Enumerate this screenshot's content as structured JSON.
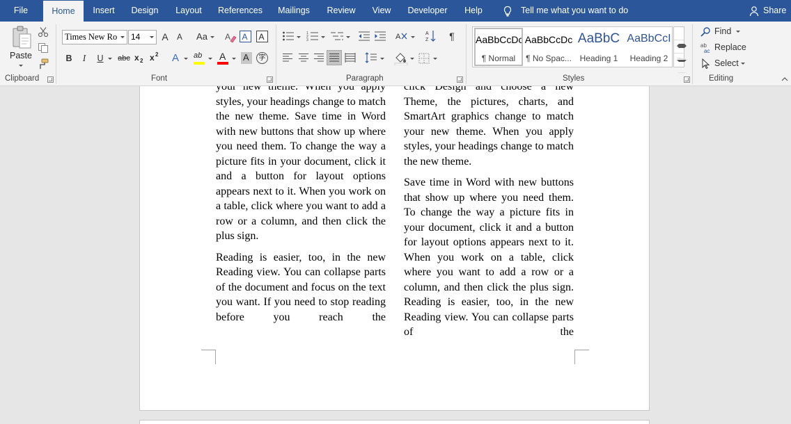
{
  "tabs": [
    {
      "label": "File"
    },
    {
      "label": "Home"
    },
    {
      "label": "Insert"
    },
    {
      "label": "Design"
    },
    {
      "label": "Layout"
    },
    {
      "label": "References"
    },
    {
      "label": "Mailings"
    },
    {
      "label": "Review"
    },
    {
      "label": "View"
    },
    {
      "label": "Developer"
    },
    {
      "label": "Help"
    }
  ],
  "tell_me": "Tell me what you want to do",
  "share": "Share",
  "clipboard": {
    "paste_label": "Paste",
    "group_label": "Clipboard"
  },
  "font": {
    "name_value": "Times New Ro",
    "size_value": "14",
    "group_label": "Font",
    "change_case": "Aa",
    "grow": "A",
    "shrink": "A",
    "bold": "B",
    "italic": "I",
    "underline": "U",
    "strike": "abc",
    "subscript": "x",
    "superscript": "x",
    "effects": "A",
    "highlight": "ab",
    "font_color": "A",
    "shading": "A",
    "enclosed": "字",
    "colors": {
      "highlight": "#ffff00",
      "font_color": "#ff0000"
    }
  },
  "paragraph": {
    "group_label": "Paragraph"
  },
  "styles": {
    "group_label": "Styles",
    "items": [
      {
        "sample": "AaBbCcDc",
        "name": "¶ Normal",
        "selected": true
      },
      {
        "sample": "AaBbCcDc",
        "name": "¶ No Spac..."
      },
      {
        "sample": "AaBbC",
        "name": "Heading 1"
      },
      {
        "sample": "AaBbCcI",
        "name": "Heading 2"
      }
    ]
  },
  "editing": {
    "group_label": "Editing",
    "find": "Find",
    "replace": "Replace",
    "select": "Select"
  },
  "accent_color": "#2b579a",
  "document": {
    "columns": [
      {
        "paragraphs": [
          "your new theme. When you apply styles, your headings change to match the new theme. Save time in Word with new buttons that show up where you need them. To change the way a picture fits in your document, click it and a button for layout options appears next to it. When you work on a table, click where you want to add a row or a column, and then click the plus sign.",
          "Reading is easier, too, in the new Reading view. You can collapse parts of the document and focus on the text you want. If you need to stop reading before you reach the"
        ]
      },
      {
        "paragraphs": [
          "click Design and choose a new Theme, the pictures, charts, and SmartArt graphics change to match your new theme. When you apply styles, your headings change to match the new theme.",
          "Save time in Word with new buttons that show up where you need them. To change the way a picture fits in your document, click it and a button for layout options appears next to it. When you work on a table, click where you want to add a row or a column, and then click the plus sign. Reading is easier, too, in the new Reading view. You can collapse parts of the"
        ]
      }
    ]
  }
}
